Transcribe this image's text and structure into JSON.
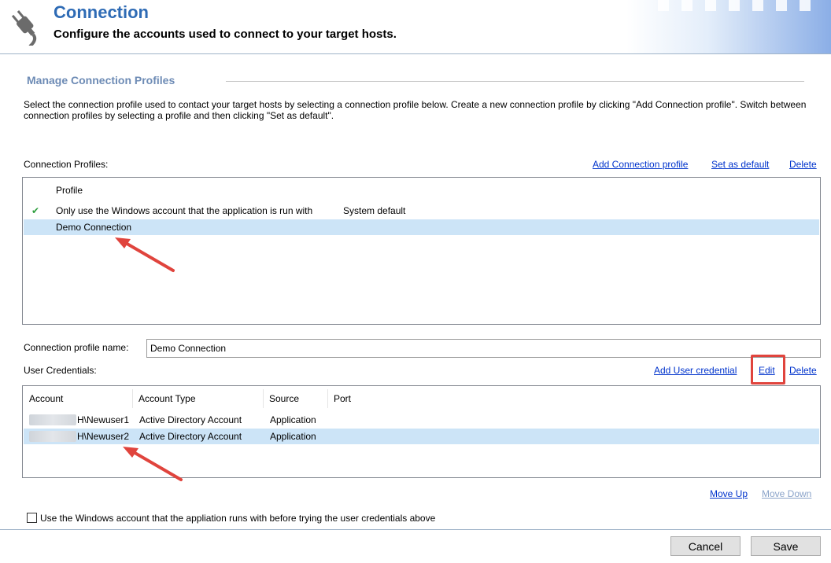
{
  "header": {
    "title": "Connection",
    "subtitle": "Configure the accounts used to connect to your target hosts."
  },
  "section": {
    "title": "Manage Connection Profiles",
    "description": "Select the connection profile used to contact your target hosts by selecting a connection profile below. Create a new connection profile by clicking \"Add Connection profile\". Switch between connection profiles by selecting a profile and then clicking \"Set as default\"."
  },
  "profiles": {
    "label": "Connection Profiles:",
    "actions": {
      "add": "Add Connection profile",
      "set_default": "Set as default",
      "delete": "Delete"
    },
    "column_header": "Profile",
    "rows": [
      {
        "check": "✔",
        "name": "Only use the Windows account that the application is run with",
        "tag": "System default"
      },
      {
        "check": "",
        "name": "Demo Connection",
        "tag": ""
      }
    ],
    "selected_index": 1
  },
  "profile_name": {
    "label": "Connection profile name:",
    "value": "Demo Connection"
  },
  "credentials": {
    "label": "User Credentials:",
    "actions": {
      "add": "Add User credential",
      "edit": "Edit",
      "delete": "Delete"
    },
    "columns": [
      "Account",
      "Account Type",
      "Source",
      "Port"
    ],
    "rows": [
      {
        "account": "H\\Newuser1",
        "type": "Active Directory Account",
        "source": "Application",
        "port": ""
      },
      {
        "account": "H\\Newuser2",
        "type": "Active Directory Account",
        "source": "Application",
        "port": ""
      }
    ],
    "selected_index": 1,
    "move_up": "Move Up",
    "move_down": "Move Down"
  },
  "option": {
    "checked": false,
    "label": "Use the Windows account that the appliation runs with before trying the user credentials above"
  },
  "footer": {
    "cancel": "Cancel",
    "save": "Save"
  },
  "colors": {
    "title": "#2e6bb5",
    "section_head": "#6d8bb5",
    "link": "#0033cc",
    "selection": "#cce4f7",
    "annotation": "#e0443d"
  }
}
